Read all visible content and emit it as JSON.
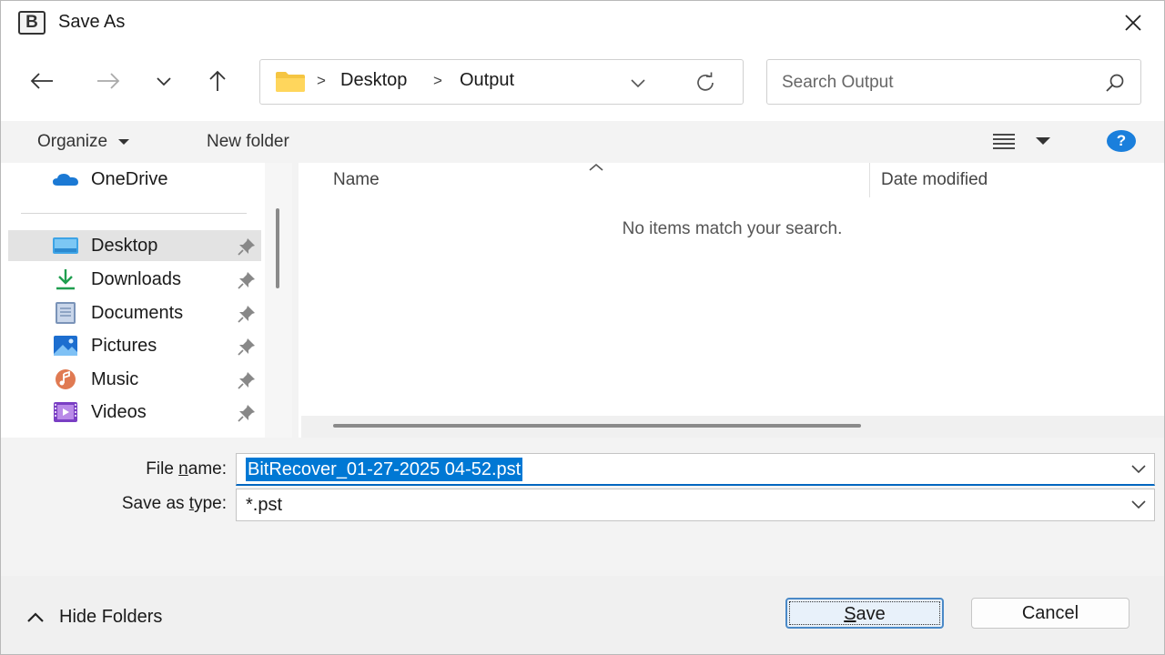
{
  "window": {
    "title": "Save As",
    "app_icon_letter": "B"
  },
  "address_bar": {
    "breadcrumbs": [
      "Desktop",
      "Output"
    ]
  },
  "search": {
    "placeholder": "Search Output"
  },
  "command_bar": {
    "organize": "Organize",
    "new_folder": "New folder",
    "help": "?"
  },
  "sidebar": {
    "onedrive": "OneDrive",
    "items": [
      {
        "label": "Desktop",
        "icon": "desktop-icon",
        "selected": true
      },
      {
        "label": "Downloads",
        "icon": "downloads-icon"
      },
      {
        "label": "Documents",
        "icon": "documents-icon"
      },
      {
        "label": "Pictures",
        "icon": "pictures-icon"
      },
      {
        "label": "Music",
        "icon": "music-icon"
      },
      {
        "label": "Videos",
        "icon": "videos-icon"
      }
    ]
  },
  "file_list": {
    "columns": [
      "Name",
      "Date modified"
    ],
    "empty_message": "No items match your search."
  },
  "form": {
    "file_name_label_pre": "File ",
    "file_name_label_u": "n",
    "file_name_label_post": "ame:",
    "file_name_value": "BitRecover_01-27-2025 04-52.pst",
    "type_label_pre": "Save as ",
    "type_label_u": "t",
    "type_label_post": "ype:",
    "type_value": "*.pst"
  },
  "footer": {
    "hide_folders": "Hide Folders",
    "save_u": "S",
    "save_rest": "ave",
    "cancel": "Cancel"
  },
  "colors": {
    "accent": "#0078d4",
    "help": "#1a7fdc"
  }
}
